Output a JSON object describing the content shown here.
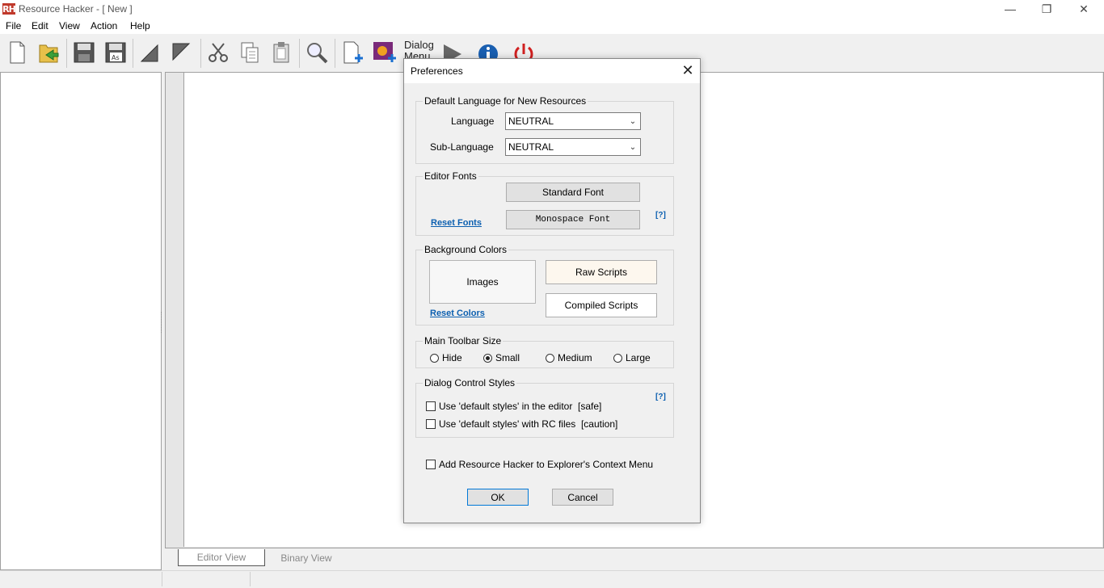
{
  "app": {
    "icon_text": "RH",
    "title": "Resource Hacker - [ New ]"
  },
  "window_controls": {
    "minimize": "—",
    "restore": "❐",
    "close": "✕"
  },
  "menu": [
    "File",
    "Edit",
    "View",
    "Action",
    "Help"
  ],
  "toolbar": {
    "dialog_menu_label_1": "Dialog",
    "dialog_menu_label_2": "Menu"
  },
  "tabs": {
    "editor_view": "Editor View",
    "binary_view": "Binary View"
  },
  "dialog": {
    "title": "Preferences",
    "close_glyph": "✕",
    "language_group": {
      "title": "Default Language for New Resources",
      "language_label": "Language",
      "language_value": "NEUTRAL",
      "sublanguage_label": "Sub-Language",
      "sublanguage_value": "NEUTRAL"
    },
    "fonts_group": {
      "title": "Editor Fonts",
      "standard_font": "Standard Font",
      "monospace_font": "Monospace Font",
      "reset_fonts": "Reset Fonts",
      "help": "[?]"
    },
    "colors_group": {
      "title": "Background Colors",
      "images": "Images",
      "raw_scripts": "Raw Scripts",
      "compiled_scripts": "Compiled Scripts",
      "reset_colors": "Reset Colors",
      "raw_scripts_color": "#fdf7ee"
    },
    "toolbar_group": {
      "title": "Main Toolbar Size",
      "options": [
        "Hide",
        "Small",
        "Medium",
        "Large"
      ],
      "selected": "Small"
    },
    "styles_group": {
      "title": "Dialog Control Styles",
      "help": "[?]",
      "option_editor": "Use 'default styles' in the editor  [safe]",
      "option_rc": "Use 'default styles' with RC files  [caution]"
    },
    "context_menu_option": "Add Resource Hacker to Explorer's Context Menu",
    "ok": "OK",
    "cancel": "Cancel"
  }
}
